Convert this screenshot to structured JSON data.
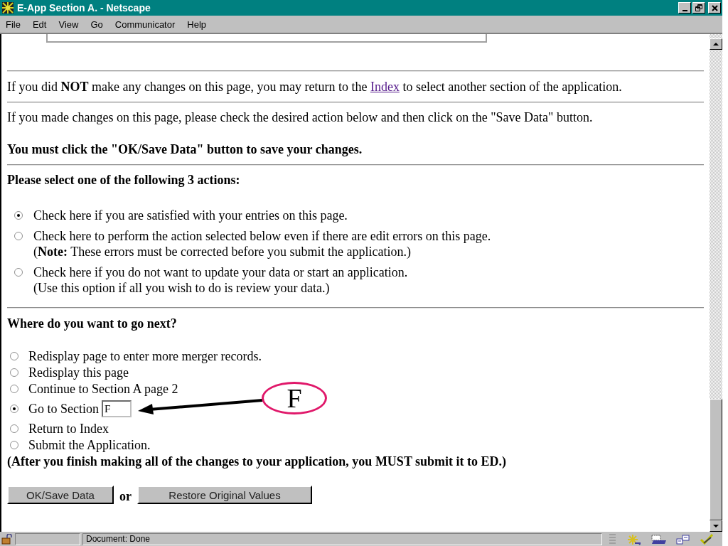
{
  "window": {
    "title": "E-App Section A. - Netscape"
  },
  "menu": [
    "File",
    "Edt",
    "View",
    "Go",
    "Communicator",
    "Help"
  ],
  "page": {
    "index_note": {
      "before": "If you did **NOT** make any changes on this page, you may return to the",
      "link": "Index",
      "after": "to select another section of the application."
    },
    "changes_note": "If you made changes on this page, please check the desired action below and then click on the \"Save Data\" button.",
    "warning": "You must click the \"OK/Save Data\" button to save your changes.",
    "actions_heading": "Please select one of the following 3 actions:",
    "actions": [
      {
        "text": "Check here if you are satisfied with your entries on this page.",
        "selected": true
      },
      {
        "text": "Check here to perform the action selected below even if there are edit errors on this page.",
        "note": "(**Note:** These errors must be corrected before you submit the application.)",
        "selected": false
      },
      {
        "text": "Check here if you do not want to update your data or start an application.",
        "note": "(Use this option if all you wish to do is review your data.)",
        "selected": false
      }
    ],
    "next_heading": "Where do you want to go next?",
    "destinations": [
      {
        "kind": "plain",
        "text": "Redisplay page to enter more merger records.",
        "selected": false
      },
      {
        "kind": "plain",
        "text": "Redisplay this page",
        "selected": false
      },
      {
        "kind": "plain",
        "text": "Continue to Section A page 2",
        "selected": false
      },
      {
        "kind": "field",
        "text": "Go to Section",
        "value": "F",
        "selected": true
      },
      {
        "kind": "plain",
        "text": "Return to Index",
        "selected": false
      },
      {
        "kind": "plain",
        "text": "Submit the Application.",
        "selected": false
      }
    ],
    "submit_note": "(After you finish making all of the changes to your application, you MUST submit it to ED.)",
    "buttons": {
      "save": "OK/Save Data",
      "separator": "or",
      "restore": "Restore Original Values"
    }
  },
  "annotation": {
    "label": "F"
  },
  "status_bar": {
    "message": "Document: Done"
  }
}
